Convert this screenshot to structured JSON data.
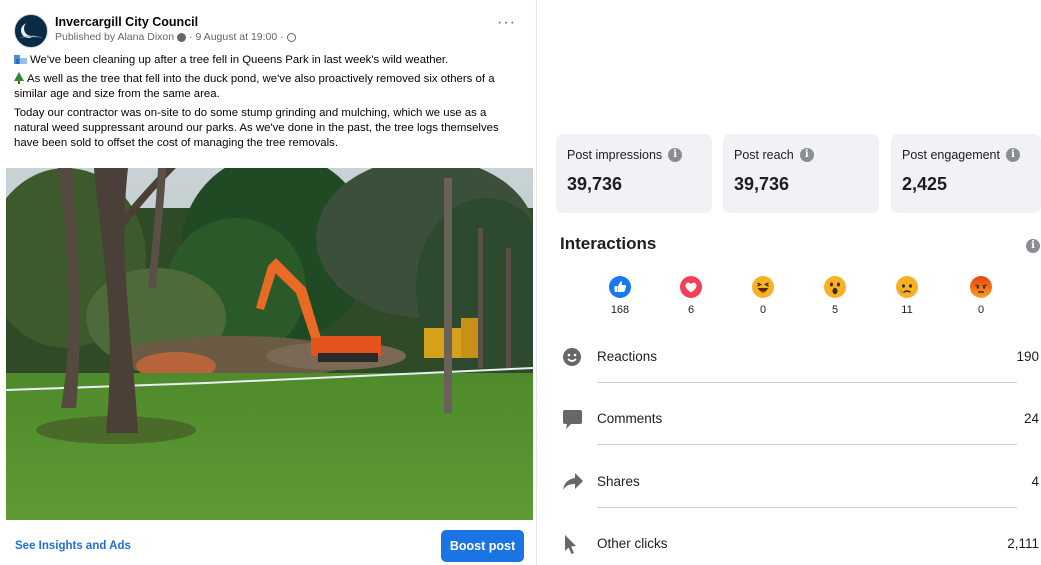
{
  "post": {
    "page_name": "Invercargill City Council",
    "published_by": "Published by Alana Dixon",
    "date": "· 9 August at 19:00 ·",
    "paragraphs": [
      "We've been cleaning up after a tree fell in Queens Park in last week's wild weather.",
      "As well as the tree that fell into the duck pond, we've also proactively removed six others of a similar age and size from the same area.",
      "Today our contractor was on-site to do some stump grinding and mulching, which we use as a natural weed suppressant around our parks. As we've done in the past, the tree logs themselves have been sold to offset the cost of managing the tree removals."
    ],
    "see_insights": "See Insights and Ads",
    "boost_label": "Boost post"
  },
  "stats": [
    {
      "label": "Post impressions",
      "value": "39,736"
    },
    {
      "label": "Post reach",
      "value": "39,736"
    },
    {
      "label": "Post engagement",
      "value": "2,425"
    }
  ],
  "interactions": {
    "title": "Interactions",
    "reactions": [
      {
        "icon": "like-icon",
        "count": "168",
        "color": "#1877f2"
      },
      {
        "icon": "love-icon",
        "count": "6",
        "color": "#f33e58"
      },
      {
        "icon": "haha-icon",
        "count": "0",
        "color": "#f7b125"
      },
      {
        "icon": "wow-icon",
        "count": "5",
        "color": "#f7b125"
      },
      {
        "icon": "sad-icon",
        "count": "11",
        "color": "#f7b125"
      },
      {
        "icon": "angry-icon",
        "count": "0",
        "color": "#e9710f"
      }
    ],
    "metrics": [
      {
        "icon": "smiley-icon",
        "label": "Reactions",
        "value": "190"
      },
      {
        "icon": "comment-icon",
        "label": "Comments",
        "value": "24"
      },
      {
        "icon": "share-icon",
        "label": "Shares",
        "value": "4"
      },
      {
        "icon": "cursor-icon",
        "label": "Other clicks",
        "value": "2,111"
      }
    ]
  }
}
